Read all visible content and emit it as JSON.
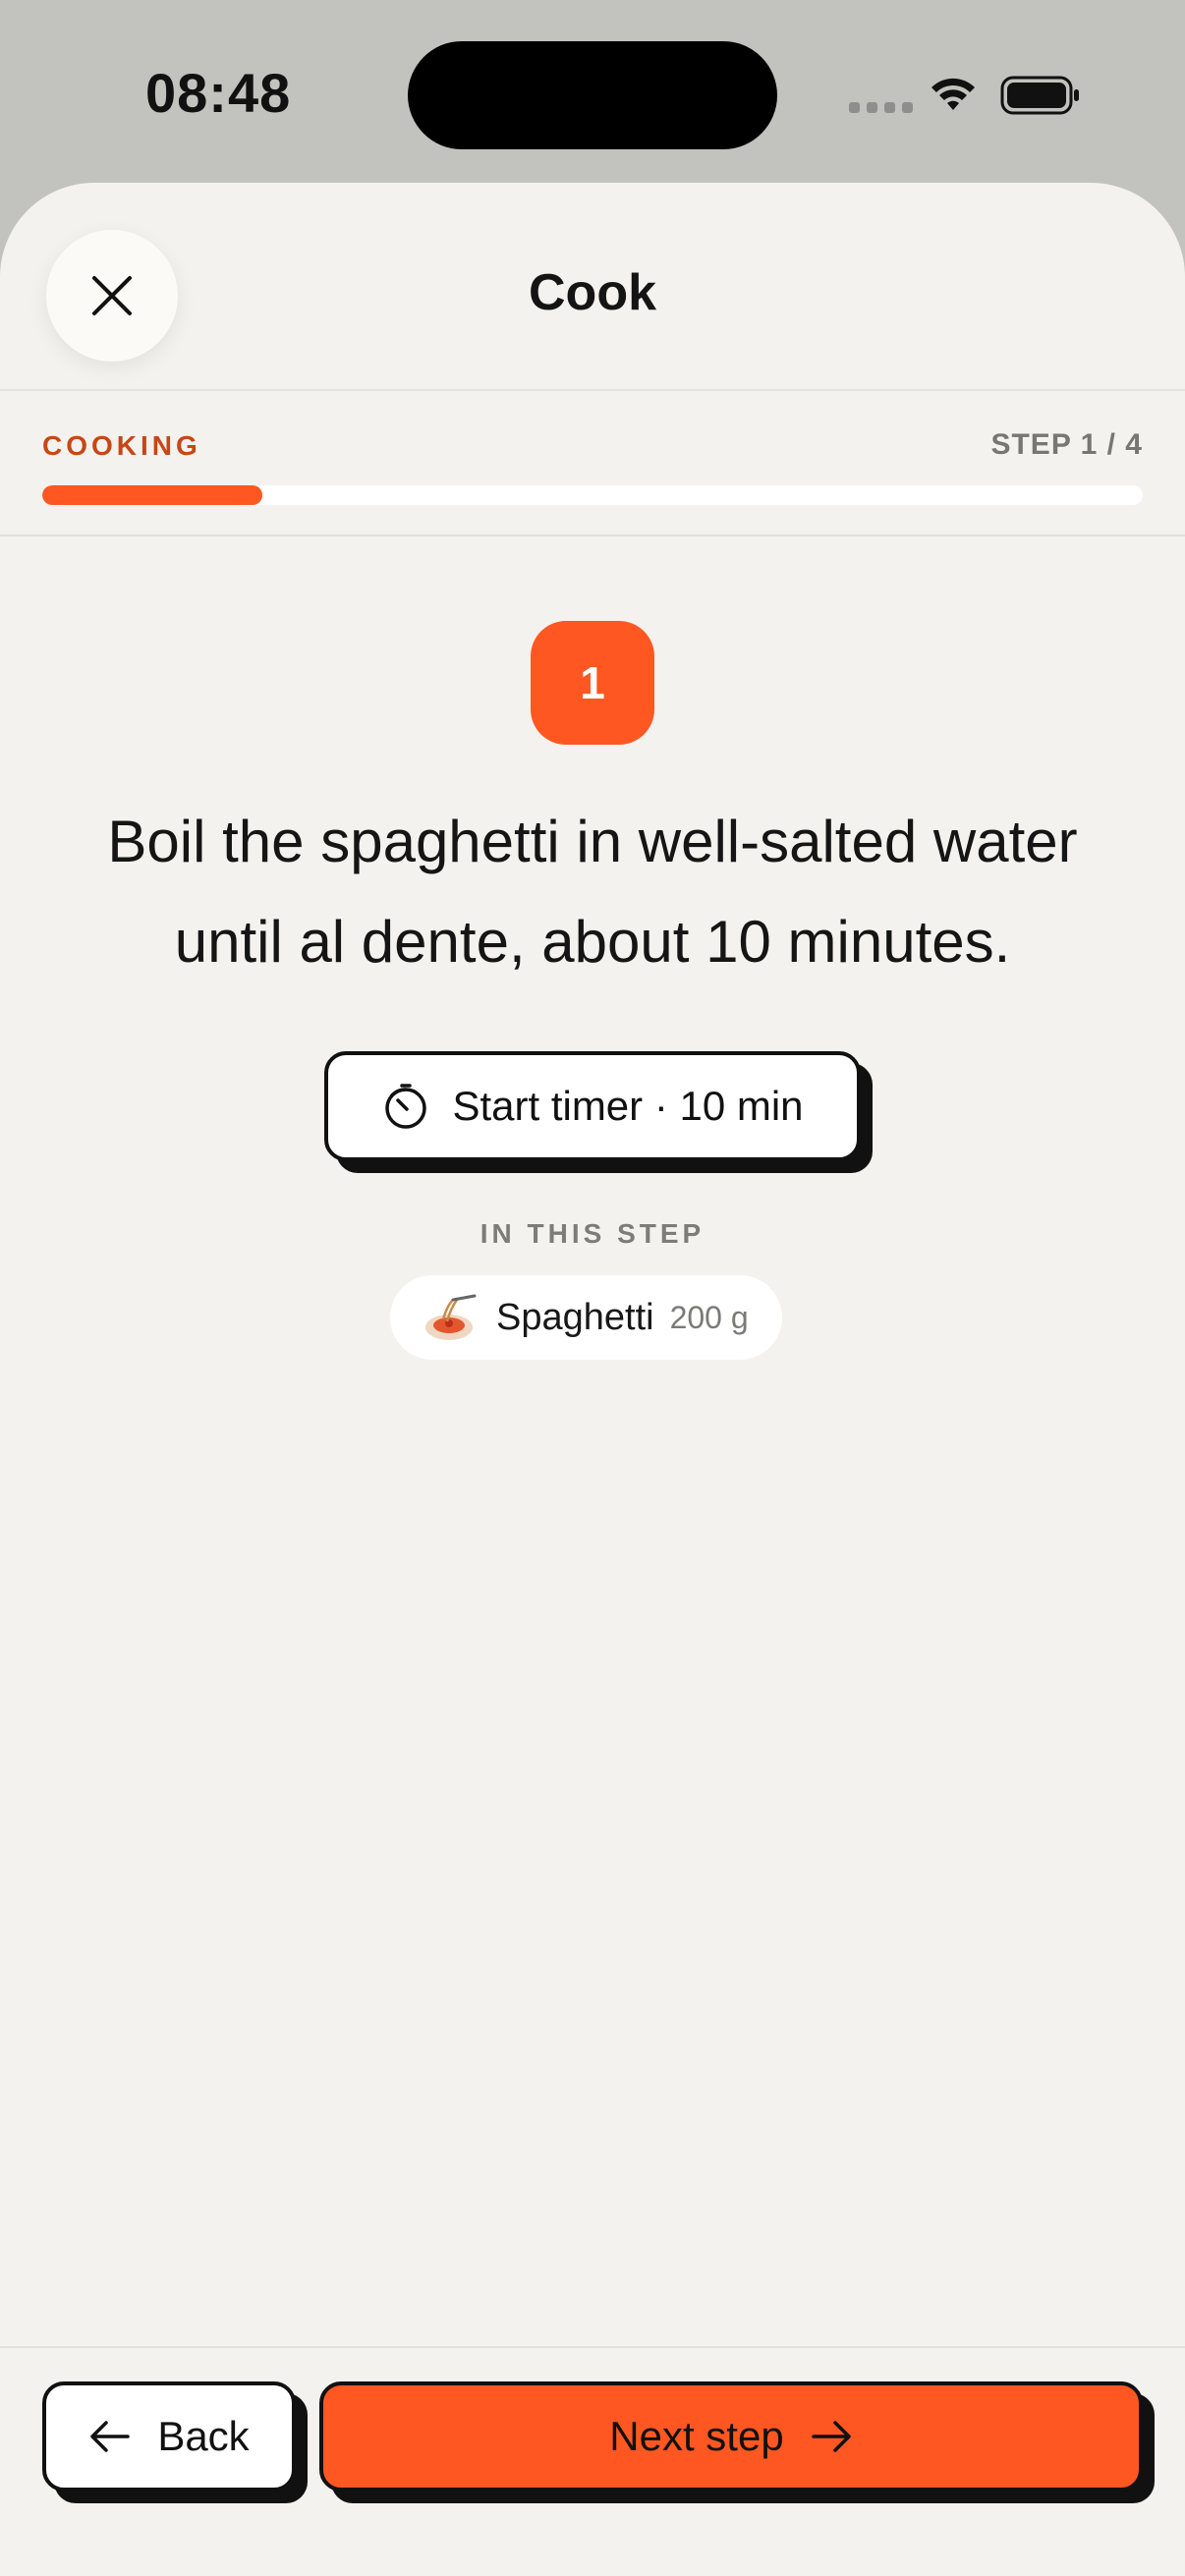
{
  "status_bar": {
    "time": "08:48",
    "icons": [
      "signal-dots-icon",
      "wifi-icon",
      "battery-icon"
    ]
  },
  "header": {
    "title": "Cook",
    "close_icon": "close-icon"
  },
  "progress": {
    "label": "COOKING",
    "step_counter": "STEP 1 / 4",
    "current_step": 1,
    "total_steps": 4,
    "fraction": 0.2
  },
  "step": {
    "number": "1",
    "instruction": "Boil the spaghetti in well-salted water until al dente, about 10 minutes.",
    "timer_label": "Start timer · 10 min",
    "timer_icon": "stopwatch-icon",
    "in_this_step_label": "IN THIS STEP",
    "ingredients": [
      {
        "icon": "spaghetti-icon",
        "name": "Spaghetti",
        "quantity": "200 g"
      }
    ]
  },
  "footer": {
    "back_label": "Back",
    "next_label": "Next step"
  },
  "colors": {
    "accent": "#ff5722",
    "accent_text": "#c84616",
    "background": "#f3f2ee",
    "ink": "#111111"
  }
}
